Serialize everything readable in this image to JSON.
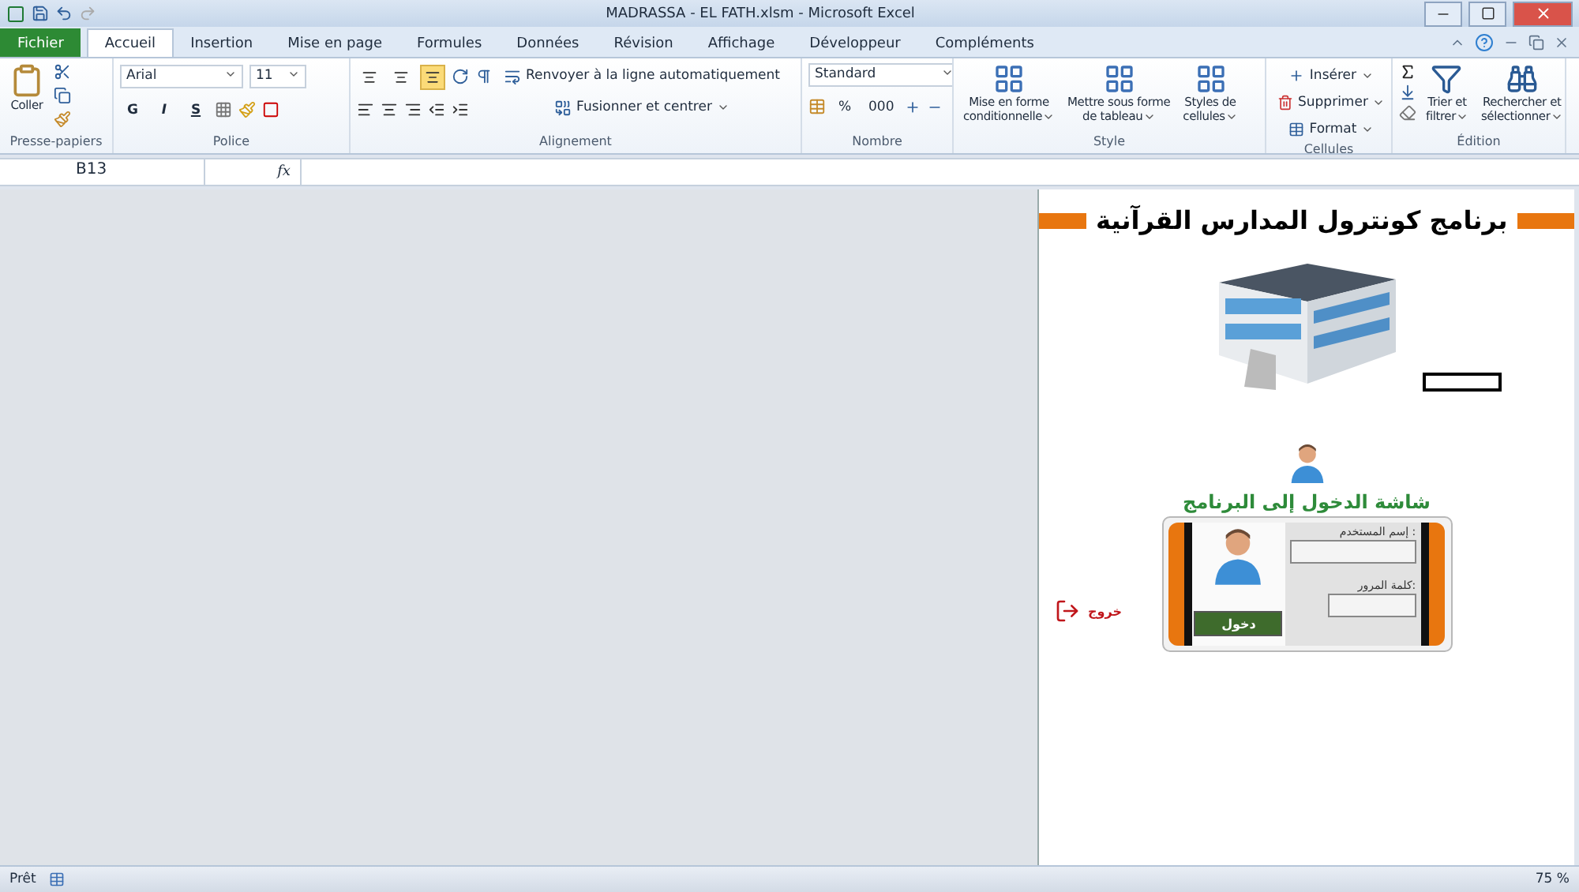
{
  "window": {
    "title": "MADRASSA - EL FATH.xlsm  -  Microsoft Excel"
  },
  "tabs": [
    {
      "label": "Fichier",
      "kind": "file",
      "selected": false
    },
    {
      "label": "Accueil",
      "kind": "tab",
      "selected": true
    },
    {
      "label": "Insertion",
      "kind": "tab",
      "selected": false
    },
    {
      "label": "Mise en page",
      "kind": "tab",
      "selected": false
    },
    {
      "label": "Formules",
      "kind": "tab",
      "selected": false
    },
    {
      "label": "Données",
      "kind": "tab",
      "selected": false
    },
    {
      "label": "Révision",
      "kind": "tab",
      "selected": false
    },
    {
      "label": "Affichage",
      "kind": "tab",
      "selected": false
    },
    {
      "label": "Développeur",
      "kind": "tab",
      "selected": false
    },
    {
      "label": "Compléments",
      "kind": "tab",
      "selected": false
    }
  ],
  "ribbon": {
    "groups": [
      {
        "kind": "clipboard",
        "label": "Presse-papiers",
        "paste": "Coller"
      },
      {
        "kind": "font",
        "label": "Police",
        "font": "Arial",
        "size": "11",
        "styles": [
          "G",
          "I",
          "S"
        ]
      },
      {
        "kind": "alignment",
        "label": "Alignement",
        "wrap": "Renvoyer à la ligne automatiquement",
        "merge": "Fusionner et centrer",
        "vertical_align": [
          {
            "selected": false
          },
          {
            "selected": false
          },
          {
            "selected": true
          }
        ]
      },
      {
        "kind": "number",
        "label": "Nombre",
        "format": "Standard",
        "symbols": [
          "%",
          "000"
        ]
      },
      {
        "kind": "style",
        "label": "Style",
        "buttons": [
          [
            "Mise en forme",
            "conditionnelle"
          ],
          [
            "Mettre sous forme",
            "de tableau"
          ],
          [
            "Styles de",
            "cellules"
          ]
        ]
      },
      {
        "kind": "cells",
        "label": "Cellules",
        "buttons": [
          "Insérer",
          "Supprimer",
          "Format"
        ]
      },
      {
        "kind": "editing",
        "label": "Édition",
        "buttons": [
          [
            "Trier et",
            "filtrer"
          ],
          [
            "Rechercher et",
            "sélectionner"
          ]
        ]
      }
    ]
  },
  "formula_bar": {
    "cell_ref": "B13",
    "function_label": "fx"
  },
  "sheet": {
    "title": "برنامج كونترول المدارس القرآنية",
    "login_heading": "شاشة الدخول إلى البرنامج",
    "username_label": "إسم المستخدم :",
    "password_label": "كلمة المرور:",
    "login_button": "دخول",
    "exit_button": "خروج"
  },
  "status_bar": {
    "status": "Prêt",
    "zoom": "75 %"
  }
}
